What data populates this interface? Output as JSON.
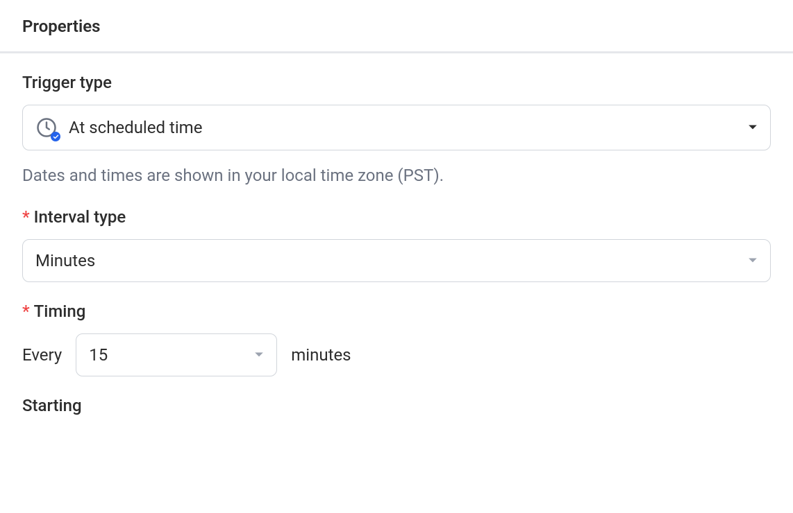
{
  "header": {
    "title": "Properties"
  },
  "triggerType": {
    "label": "Trigger type",
    "value": "At scheduled time",
    "helper": "Dates and times are shown in your local time zone (PST)."
  },
  "intervalType": {
    "label": "Interval type",
    "value": "Minutes"
  },
  "timing": {
    "label": "Timing",
    "prefix": "Every",
    "value": "15",
    "suffix": "minutes"
  },
  "starting": {
    "label": "Starting"
  }
}
